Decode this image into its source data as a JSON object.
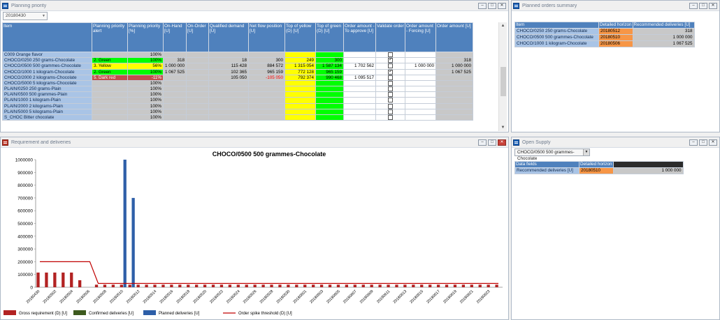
{
  "planning_priority": {
    "title": "Planning priority",
    "date_selector": "20180430",
    "columns": [
      "Item",
      "Planning priority alert",
      "Planning priority [%]",
      "On-Hand [U]",
      "On-Order [U]",
      "Qualified demand [U]",
      "Net flow position [U]",
      "Top of yellow (D) [U]",
      "Top of green (D) [U]",
      "Order amount - To approve [U]",
      "Validate order",
      "Order amount - Forcing [U]",
      "Order amount [U]"
    ],
    "rows": [
      {
        "item": "C009 Orange flavor",
        "alert": "",
        "alert_color": "",
        "pct": "100%",
        "pct_color": "",
        "onhand": "",
        "onorder": "",
        "qual": "",
        "nfp": "",
        "toy": "",
        "tog": "",
        "approve": "",
        "validate": false,
        "forcing": "",
        "amount": ""
      },
      {
        "item": "CHOCO/0250 250 grams-Chocolate",
        "alert": "2. Green",
        "alert_color": "green",
        "pct": "100%",
        "pct_color": "green",
        "onhand": "318",
        "onorder": "",
        "qual": "18",
        "nfp": "300",
        "toy": "249",
        "tog": "300",
        "approve": "",
        "validate": true,
        "forcing": "",
        "amount": "318"
      },
      {
        "item": "CHOCO/0500 500 grammes-Chocolate",
        "alert": "3. Yellow",
        "alert_color": "yellow",
        "pct": "56%",
        "pct_color": "yellow",
        "onhand": "1 000 000",
        "onorder": "",
        "qual": "115 428",
        "nfp": "884 572",
        "toy": "1 315 054",
        "tog": "1 587 134",
        "approve": "1 702 562",
        "validate": false,
        "forcing": "1 000 000",
        "amount": "1 000 000"
      },
      {
        "item": "CHOCO/1000 1 kilogram-Chocolate",
        "alert": "2. Green",
        "alert_color": "green",
        "pct": "100%",
        "pct_color": "green",
        "onhand": "1 067 525",
        "onorder": "",
        "qual": "102 365",
        "nfp": "965 159",
        "toy": "772 128",
        "tog": "965 159",
        "approve": "",
        "validate": true,
        "forcing": "",
        "amount": "1 067 525"
      },
      {
        "item": "CHOCO/2000 2 kilograms-Chocolate",
        "alert": "5. Dark red",
        "alert_color": "darkred",
        "pct": "-11%",
        "pct_color": "darkred",
        "onhand": "",
        "onorder": "",
        "qual": "105 050",
        "nfp": "-105 050",
        "toy": "792 374",
        "tog": "990 468",
        "approve": "1 095 517",
        "validate": false,
        "forcing": "",
        "amount": ""
      },
      {
        "item": "CHOCO/5000 5 kilograms-Chocolate",
        "alert": "",
        "alert_color": "",
        "pct": "100%",
        "pct_color": "",
        "onhand": "",
        "onorder": "",
        "qual": "",
        "nfp": "",
        "toy": "",
        "tog": "",
        "approve": "",
        "validate": false,
        "forcing": "",
        "amount": ""
      },
      {
        "item": "PLAIN/0250 250 grams-Plain",
        "alert": "",
        "alert_color": "",
        "pct": "100%",
        "pct_color": "",
        "onhand": "",
        "onorder": "",
        "qual": "",
        "nfp": "",
        "toy": "",
        "tog": "",
        "approve": "",
        "validate": false,
        "forcing": "",
        "amount": ""
      },
      {
        "item": "PLAIN/0500 500 grammes-Plain",
        "alert": "",
        "alert_color": "",
        "pct": "100%",
        "pct_color": "",
        "onhand": "",
        "onorder": "",
        "qual": "",
        "nfp": "",
        "toy": "",
        "tog": "",
        "approve": "",
        "validate": false,
        "forcing": "",
        "amount": ""
      },
      {
        "item": "PLAIN/1000 1 kilogram-Plain",
        "alert": "",
        "alert_color": "",
        "pct": "100%",
        "pct_color": "",
        "onhand": "",
        "onorder": "",
        "qual": "",
        "nfp": "",
        "toy": "",
        "tog": "",
        "approve": "",
        "validate": false,
        "forcing": "",
        "amount": ""
      },
      {
        "item": "PLAIN/2000 2 kilograms-Plain",
        "alert": "",
        "alert_color": "",
        "pct": "100%",
        "pct_color": "",
        "onhand": "",
        "onorder": "",
        "qual": "",
        "nfp": "",
        "toy": "",
        "tog": "",
        "approve": "",
        "validate": false,
        "forcing": "",
        "amount": ""
      },
      {
        "item": "PLAIN/5000 5 kilograms-Plain",
        "alert": "",
        "alert_color": "",
        "pct": "100%",
        "pct_color": "",
        "onhand": "",
        "onorder": "",
        "qual": "",
        "nfp": "",
        "toy": "",
        "tog": "",
        "approve": "",
        "validate": false,
        "forcing": "",
        "amount": ""
      },
      {
        "item": "S_CHOC Bitter chocolate",
        "alert": "",
        "alert_color": "",
        "pct": "100%",
        "pct_color": "",
        "onhand": "",
        "onorder": "",
        "qual": "",
        "nfp": "",
        "toy": "",
        "tog": "",
        "approve": "",
        "validate": false,
        "forcing": "",
        "amount": ""
      }
    ]
  },
  "planned_orders_summary": {
    "title": "Planned orders summary",
    "columns": [
      "Item",
      "Detailed horizon",
      "Recommended deliveries [U]"
    ],
    "rows": [
      {
        "item": "CHOCO/0250 250 grams-Chocolate",
        "date": "20180512",
        "value": "318"
      },
      {
        "item": "CHOCO/0500 500 grammes-Chocolate",
        "date": "20180510",
        "value": "1 000 000"
      },
      {
        "item": "CHOCO/1000 1 kilogram-Chocolate",
        "date": "20180506",
        "value": "1 067 525"
      }
    ]
  },
  "requirement_chart": {
    "title": "Requirement and deliveries"
  },
  "open_supply": {
    "title": "Open Supply",
    "item_selector": "CHOCO/0500 500 grammes-Chocolate",
    "columns": [
      "Data fields",
      "Detailed horizon",
      ""
    ],
    "rows": [
      {
        "field": "Recommended deliveries [U]",
        "date": "20180510",
        "value": "1 000 000"
      }
    ]
  },
  "colors": {
    "header_blue": "#4f81bd",
    "item_blue": "#a9c4e6",
    "gross": "#b22222",
    "confirmed": "#3d5a1e",
    "planned": "#2e5fa8",
    "threshold": "#c00000"
  },
  "chart_data": {
    "type": "bar",
    "title": "CHOCO/0500 500 grammes-Chocolate",
    "xlabel": "",
    "ylabel": "",
    "ylim": [
      0,
      1000000
    ],
    "yticks": [
      0,
      100000,
      200000,
      300000,
      400000,
      500000,
      600000,
      700000,
      800000,
      900000,
      1000000
    ],
    "categories": [
      "20180430",
      "20180501",
      "20180502",
      "20180503",
      "20180504",
      "20180505",
      "20180506",
      "20180507",
      "20180508",
      "20180509",
      "20180510",
      "20180511",
      "20180512",
      "20180513",
      "20180514",
      "20180515",
      "20180516",
      "20180517",
      "20180518",
      "20180519",
      "20180520",
      "20180521",
      "20180522",
      "20180523",
      "20180524",
      "20180525",
      "20180526",
      "20180527",
      "20180528",
      "20180529",
      "20180530",
      "20180531",
      "20180601",
      "20180602",
      "20180603",
      "20180604",
      "20180605",
      "20180606",
      "20180607",
      "20180608",
      "20180609",
      "20180610",
      "20180611",
      "20180612",
      "20180613",
      "20180614",
      "20180615",
      "20180616",
      "20180617",
      "20180618",
      "20180619",
      "20180620",
      "20180621",
      "20180622",
      "20180623",
      "20180624"
    ],
    "tick_labels_shown": [
      "20180430",
      "20180502",
      "20180504",
      "20180506",
      "20180508",
      "20180510",
      "20180512",
      "20180514",
      "20180516",
      "20180518",
      "20180520",
      "20180522",
      "20180524",
      "20180526",
      "20180528",
      "20180530",
      "20180601",
      "20180603",
      "20180605",
      "20180607",
      "20180609",
      "20180611",
      "20180613",
      "20180615",
      "20180617",
      "20180619",
      "20180621",
      "20180623"
    ],
    "legend_position": "bottom",
    "series": [
      {
        "name": "Gross requirement (D) [U]",
        "kind": "bar",
        "color": "#b22222",
        "values": [
          115000,
          115000,
          115000,
          115000,
          115000,
          55000,
          0,
          20000,
          20000,
          20000,
          20000,
          20000,
          20000,
          20000,
          20000,
          20000,
          20000,
          20000,
          20000,
          20000,
          20000,
          20000,
          20000,
          20000,
          20000,
          20000,
          20000,
          20000,
          20000,
          20000,
          20000,
          20000,
          20000,
          20000,
          20000,
          20000,
          20000,
          20000,
          20000,
          20000,
          20000,
          20000,
          20000,
          20000,
          20000,
          20000,
          20000,
          20000,
          20000,
          20000,
          20000,
          20000,
          20000,
          20000,
          20000,
          20000
        ]
      },
      {
        "name": "Confirmed deliveries [U]",
        "kind": "bar",
        "color": "#3d5a1e",
        "values": [
          0,
          0,
          0,
          0,
          0,
          0,
          0,
          0,
          0,
          0,
          0,
          0,
          0,
          0,
          0,
          0,
          0,
          0,
          0,
          0,
          0,
          0,
          0,
          0,
          0,
          0,
          0,
          0,
          0,
          0,
          0,
          0,
          0,
          0,
          0,
          0,
          0,
          0,
          0,
          0,
          0,
          0,
          0,
          0,
          0,
          0,
          0,
          0,
          0,
          0,
          0,
          0,
          0,
          0,
          0,
          0
        ]
      },
      {
        "name": "Planned deliveries [U]",
        "kind": "bar",
        "color": "#2e5fa8",
        "values": [
          0,
          0,
          0,
          0,
          0,
          0,
          0,
          0,
          0,
          0,
          1000000,
          700000,
          0,
          0,
          0,
          0,
          0,
          0,
          0,
          0,
          0,
          0,
          0,
          0,
          0,
          0,
          0,
          0,
          0,
          0,
          0,
          0,
          0,
          0,
          0,
          0,
          0,
          0,
          0,
          0,
          0,
          0,
          0,
          0,
          0,
          0,
          0,
          0,
          0,
          0,
          0,
          0,
          0,
          0,
          0,
          0
        ]
      },
      {
        "name": "Order spike threshold (D) [U]",
        "kind": "line",
        "color": "#c00000",
        "values": [
          200000,
          200000,
          200000,
          200000,
          200000,
          200000,
          200000,
          30000,
          30000,
          30000,
          30000,
          30000,
          30000,
          30000,
          30000,
          30000,
          30000,
          30000,
          30000,
          30000,
          30000,
          30000,
          30000,
          30000,
          30000,
          30000,
          30000,
          30000,
          30000,
          30000,
          30000,
          30000,
          30000,
          30000,
          30000,
          30000,
          30000,
          30000,
          30000,
          30000,
          30000,
          30000,
          30000,
          30000,
          30000,
          30000,
          30000,
          30000,
          30000,
          30000,
          30000,
          30000,
          30000,
          30000,
          30000,
          30000
        ]
      }
    ]
  }
}
